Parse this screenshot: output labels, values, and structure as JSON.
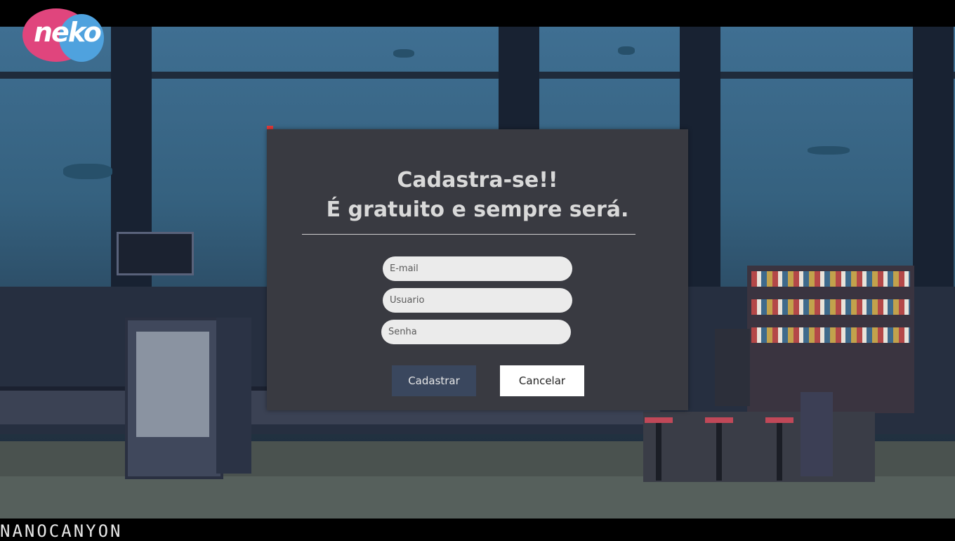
{
  "brand": {
    "logo_text": "neko"
  },
  "watermark": "NANOCANYON",
  "signup": {
    "title_line1": "Cadastra-se!!",
    "title_line2": "É gratuito e sempre será.",
    "email_placeholder": "E-mail",
    "username_placeholder": "Usuario",
    "password_placeholder": "Senha",
    "submit_label": "Cadastrar",
    "cancel_label": "Cancelar"
  },
  "colors": {
    "modal_bg": "#393a41",
    "primary_button": "#3a475e",
    "logo_pink": "#e0457d",
    "logo_blue": "#4fa2de",
    "close_dot": "#e03a3a"
  }
}
